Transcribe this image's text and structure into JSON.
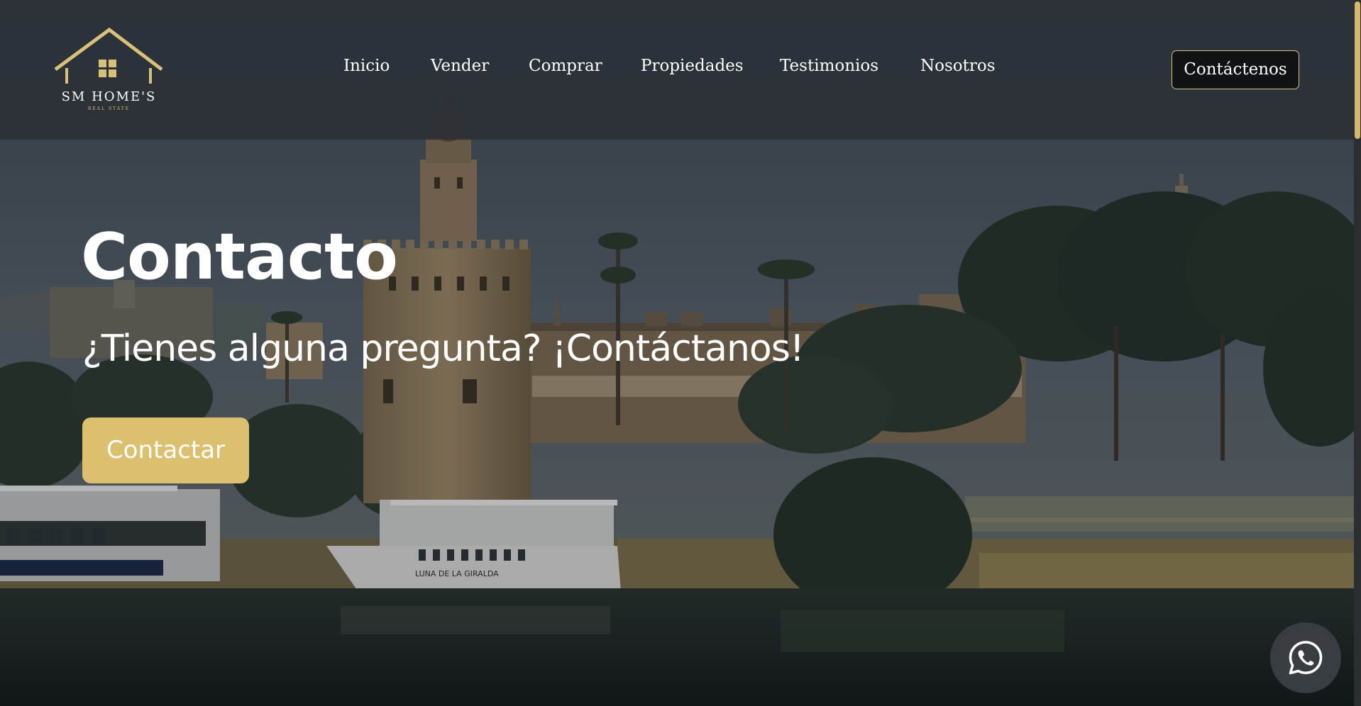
{
  "brand": {
    "name": "SM HOME'S",
    "tagline": "REAL STATE",
    "accent_color": "#dbc06f"
  },
  "nav": {
    "items": [
      {
        "label": "Inicio"
      },
      {
        "label": "Vender"
      },
      {
        "label": "Comprar"
      },
      {
        "label": "Propiedades"
      },
      {
        "label": "Testimonios"
      },
      {
        "label": "Nosotros"
      }
    ],
    "cta_label": "Contáctenos"
  },
  "hero": {
    "title": "Contacto",
    "subtitle": "¿Tienes alguna pregunta? ¡Contáctanos!",
    "button_label": "Contactar",
    "boat_name": "LUNA DE LA GIRALDA",
    "background_icon": "torre-del-oro-river-photo"
  },
  "whatsapp": {
    "icon": "whatsapp-icon"
  }
}
